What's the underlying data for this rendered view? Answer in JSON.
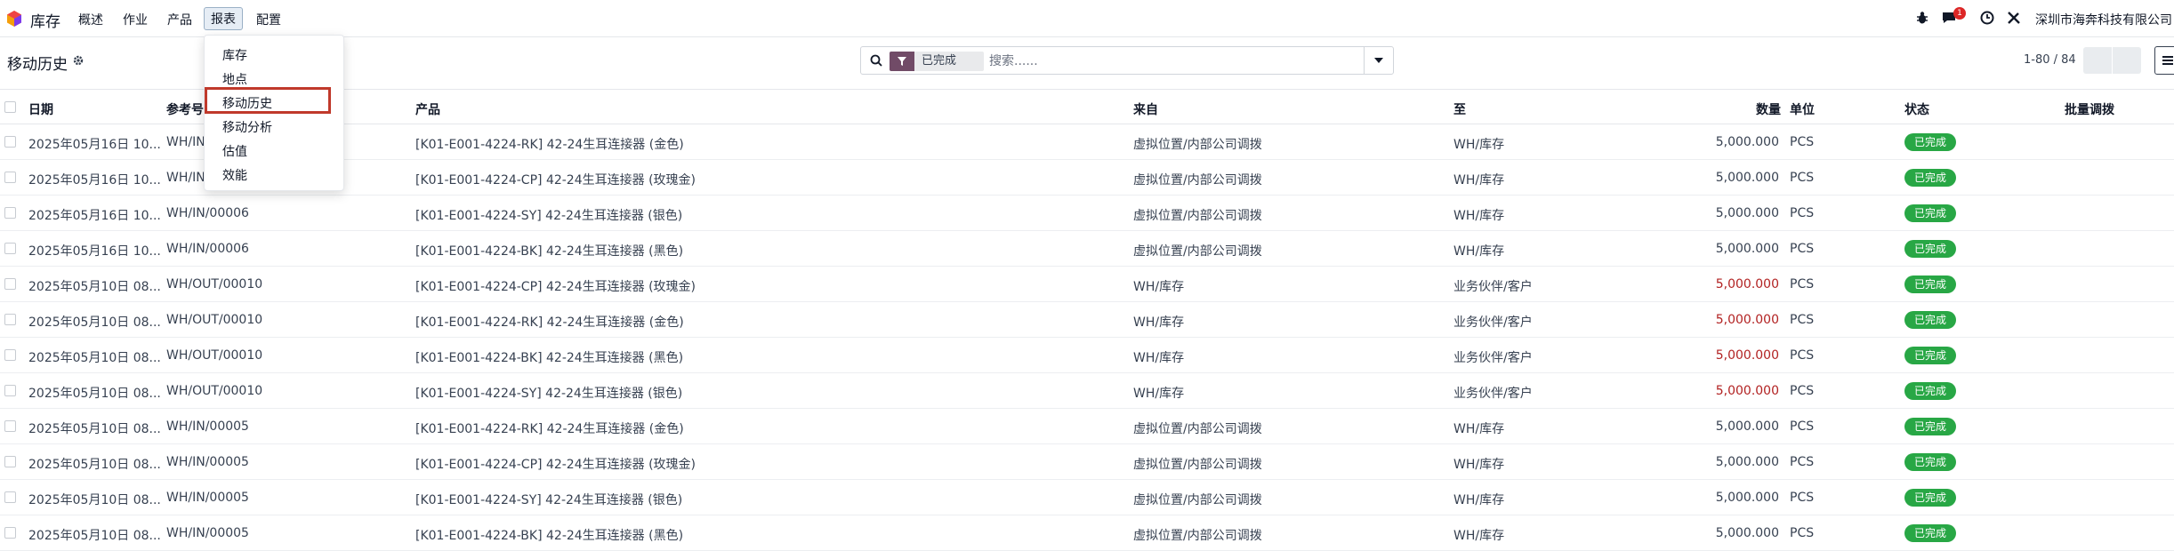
{
  "navbar": {
    "app_name": "库存",
    "menu": [
      "概述",
      "作业",
      "产品",
      "报表",
      "配置"
    ],
    "active_menu": "报表",
    "message_count": "1",
    "company": "深圳市海奔科技有限公司",
    "icons": [
      "bug-icon",
      "chat-icon",
      "clock-icon",
      "tools-icon"
    ]
  },
  "control_panel": {
    "title": "移动历史",
    "search": {
      "facet": "已完成",
      "placeholder": "搜索......"
    },
    "pager": "1-80 / 84"
  },
  "reports_menu": {
    "items": [
      "库存",
      "地点",
      "移动历史",
      "移动分析",
      "估值",
      "效能"
    ],
    "highlighted": "移动历史"
  },
  "table": {
    "columns": {
      "date": "日期",
      "reference": "参考号",
      "product": "产品",
      "from": "来自",
      "to": "至",
      "quantity": "数量",
      "unit": "单位",
      "status": "状态",
      "lot": "批量调拨"
    },
    "rows": [
      {
        "date": "2025年05月16日 10...",
        "reference": "WH/IN",
        "product": "[K01-E001-4224-RK] 42-24生耳连接器 (金色)",
        "from": "虚拟位置/内部公司调拨",
        "to": "WH/库存",
        "quantity": "5,000.000",
        "unit": "PCS",
        "status": "已完成",
        "outgoing": false
      },
      {
        "date": "2025年05月16日 10...",
        "reference": "WH/IN",
        "product": "[K01-E001-4224-CP] 42-24生耳连接器 (玫瑰金)",
        "from": "虚拟位置/内部公司调拨",
        "to": "WH/库存",
        "quantity": "5,000.000",
        "unit": "PCS",
        "status": "已完成",
        "outgoing": false
      },
      {
        "date": "2025年05月16日 10...",
        "reference": "WH/IN/00006",
        "product": "[K01-E001-4224-SY] 42-24生耳连接器 (银色)",
        "from": "虚拟位置/内部公司调拨",
        "to": "WH/库存",
        "quantity": "5,000.000",
        "unit": "PCS",
        "status": "已完成",
        "outgoing": false
      },
      {
        "date": "2025年05月16日 10...",
        "reference": "WH/IN/00006",
        "product": "[K01-E001-4224-BK] 42-24生耳连接器 (黑色)",
        "from": "虚拟位置/内部公司调拨",
        "to": "WH/库存",
        "quantity": "5,000.000",
        "unit": "PCS",
        "status": "已完成",
        "outgoing": false
      },
      {
        "date": "2025年05月10日 08...",
        "reference": "WH/OUT/00010",
        "product": "[K01-E001-4224-CP] 42-24生耳连接器 (玫瑰金)",
        "from": "WH/库存",
        "to": "业务伙伴/客户",
        "quantity": "5,000.000",
        "unit": "PCS",
        "status": "已完成",
        "outgoing": true
      },
      {
        "date": "2025年05月10日 08...",
        "reference": "WH/OUT/00010",
        "product": "[K01-E001-4224-RK] 42-24生耳连接器 (金色)",
        "from": "WH/库存",
        "to": "业务伙伴/客户",
        "quantity": "5,000.000",
        "unit": "PCS",
        "status": "已完成",
        "outgoing": true
      },
      {
        "date": "2025年05月10日 08...",
        "reference": "WH/OUT/00010",
        "product": "[K01-E001-4224-BK] 42-24生耳连接器 (黑色)",
        "from": "WH/库存",
        "to": "业务伙伴/客户",
        "quantity": "5,000.000",
        "unit": "PCS",
        "status": "已完成",
        "outgoing": true
      },
      {
        "date": "2025年05月10日 08...",
        "reference": "WH/OUT/00010",
        "product": "[K01-E001-4224-SY] 42-24生耳连接器 (银色)",
        "from": "WH/库存",
        "to": "业务伙伴/客户",
        "quantity": "5,000.000",
        "unit": "PCS",
        "status": "已完成",
        "outgoing": true
      },
      {
        "date": "2025年05月10日 08...",
        "reference": "WH/IN/00005",
        "product": "[K01-E001-4224-RK] 42-24生耳连接器 (金色)",
        "from": "虚拟位置/内部公司调拨",
        "to": "WH/库存",
        "quantity": "5,000.000",
        "unit": "PCS",
        "status": "已完成",
        "outgoing": false
      },
      {
        "date": "2025年05月10日 08...",
        "reference": "WH/IN/00005",
        "product": "[K01-E001-4224-CP] 42-24生耳连接器 (玫瑰金)",
        "from": "虚拟位置/内部公司调拨",
        "to": "WH/库存",
        "quantity": "5,000.000",
        "unit": "PCS",
        "status": "已完成",
        "outgoing": false
      },
      {
        "date": "2025年05月10日 08...",
        "reference": "WH/IN/00005",
        "product": "[K01-E001-4224-SY] 42-24生耳连接器 (银色)",
        "from": "虚拟位置/内部公司调拨",
        "to": "WH/库存",
        "quantity": "5,000.000",
        "unit": "PCS",
        "status": "已完成",
        "outgoing": false
      },
      {
        "date": "2025年05月10日 08...",
        "reference": "WH/IN/00005",
        "product": "[K01-E001-4224-BK] 42-24生耳连接器 (黑色)",
        "from": "虚拟位置/内部公司调拨",
        "to": "WH/库存",
        "quantity": "5,000.000",
        "unit": "PCS",
        "status": "已完成",
        "outgoing": false
      }
    ]
  },
  "colors": {
    "status_done": "#28a745",
    "outgoing_qty": "#b22222",
    "facet_icon": "#714b67",
    "highlight_border": "#c0392b"
  }
}
